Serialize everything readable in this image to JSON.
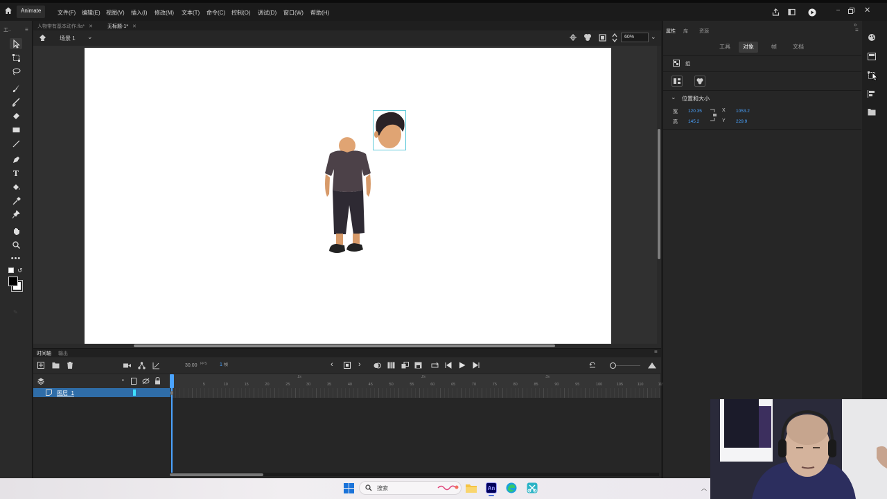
{
  "app": {
    "name": "Animate"
  },
  "menu": [
    "文件(F)",
    "编辑(E)",
    "视图(V)",
    "插入(I)",
    "修改(M)",
    "文本(T)",
    "命令(C)",
    "控制(O)",
    "调试(D)",
    "窗口(W)",
    "帮助(H)"
  ],
  "toolbar_label": "工..",
  "doc_tabs": [
    {
      "label": "人物带有基本动作.fla*"
    },
    {
      "label": "无标题-1*",
      "active": true
    }
  ],
  "stage": {
    "scene": "场景 1",
    "zoom": "60%"
  },
  "timeline": {
    "tabs": [
      "时间轴",
      "输出"
    ],
    "fps": "30.00",
    "fps_unit": "FPS",
    "frame": "1",
    "frame_unit": "帧",
    "layer_name": "图层_1",
    "second_markers": [
      "1s",
      "2s",
      "3s"
    ],
    "frame_numbers": [
      "5",
      "10",
      "15",
      "20",
      "25",
      "30",
      "35",
      "40",
      "45",
      "50",
      "55",
      "60",
      "65",
      "70",
      "75",
      "80",
      "85",
      "90",
      "95",
      "100",
      "105",
      "110",
      "115"
    ]
  },
  "properties": {
    "panel_tabs": [
      "属性",
      "库",
      "资源"
    ],
    "mode_tabs": [
      "工具",
      "对象",
      "帧",
      "文档"
    ],
    "active_mode": "对象",
    "object_type": "组",
    "section": "位置和大小",
    "width_label": "宽",
    "width": "120.35",
    "height_label": "高",
    "height": "145.2",
    "x_label": "X",
    "x": "1053.2",
    "y_label": "Y",
    "y": "229.9"
  },
  "taskbar": {
    "search_placeholder": "搜索"
  },
  "colors": {
    "accent": "#4aa3ff",
    "selected_layer": "#2f6da8",
    "app_bg": "#262626"
  }
}
